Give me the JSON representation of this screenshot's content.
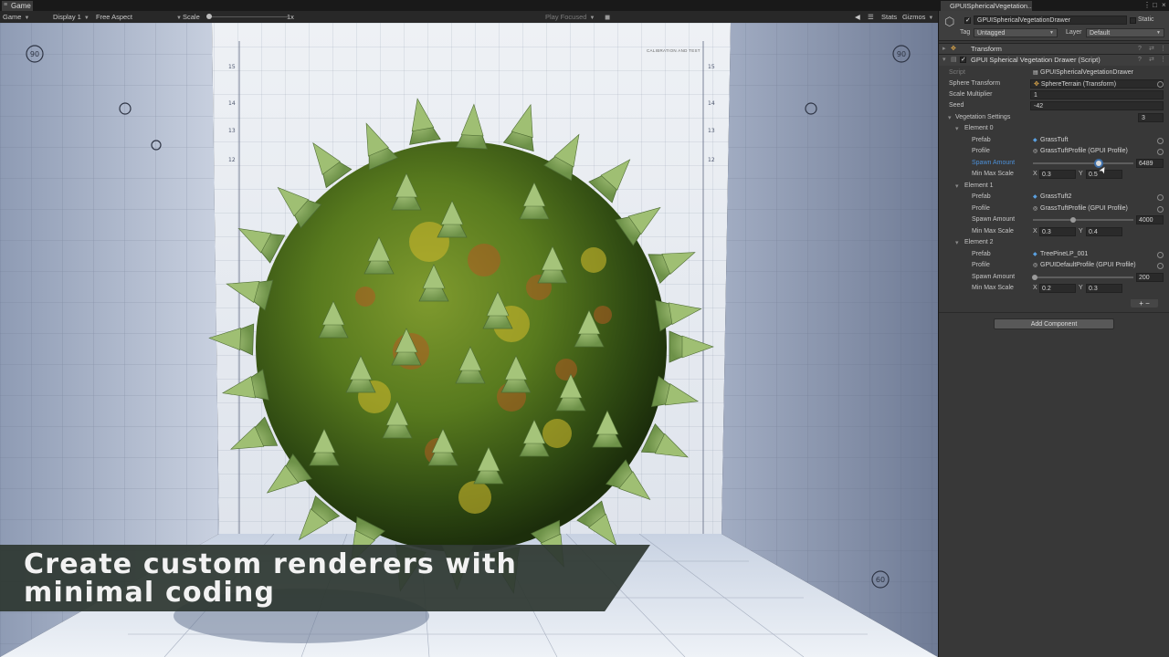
{
  "game_view": {
    "tab_label": "Game",
    "toolbar": {
      "mode": "Game",
      "display": "Display 1",
      "aspect": "Free Aspect",
      "scale_label": "Scale",
      "scale_value": "1x",
      "play_focused": "Play Focused",
      "stats": "Stats",
      "gizmos": "Gizmos"
    },
    "calibration_label": "CALIBRATION AND TEST",
    "caption": "Create custom renderers with minimal coding",
    "wall_ruler_numbers": [
      "15",
      "14",
      "13",
      "12",
      "11",
      "10",
      "9",
      "8"
    ],
    "wall_dial_numbers": [
      "90",
      "90",
      "90",
      "60",
      "60",
      "60"
    ]
  },
  "inspector": {
    "tab_label": "GPUISphericalVegetation...",
    "object_name": "GPUISphericalVegetationDrawer",
    "static_label": "Static",
    "tag_label": "Tag",
    "tag_value": "Untagged",
    "layer_label": "Layer",
    "layer_value": "Default",
    "transform_header": "Transform",
    "script_header": "GPUI Spherical Vegetation Drawer (Script)",
    "script": {
      "label": "Script",
      "value": "GPUISphericalVegetationDrawer"
    },
    "sphere_transform": {
      "label": "Sphere Transform",
      "value": "SphereTerrain (Transform)"
    },
    "scale_multiplier": {
      "label": "Scale Multiplier",
      "value": "1"
    },
    "seed": {
      "label": "Seed",
      "value": "-42"
    },
    "vegetation_settings": {
      "label": "Vegetation Settings",
      "count": "3"
    },
    "elements": [
      {
        "title": "Element 0",
        "prefab_label": "Prefab",
        "prefab": "GrassTuft",
        "profile_label": "Profile",
        "profile": "GrassTuftProfile (GPUI Profile)",
        "spawn_label": "Spawn Amount",
        "spawn": "6489",
        "spawn_fraction": 0.65,
        "scale_label": "Min Max Scale",
        "x_label": "X",
        "x": "0.3",
        "y_label": "Y",
        "y": "0.5"
      },
      {
        "title": "Element 1",
        "prefab_label": "Prefab",
        "prefab": "GrassTuft2",
        "profile_label": "Profile",
        "profile": "GrassTuftProfile (GPUI Profile)",
        "spawn_label": "Spawn Amount",
        "spawn": "4000",
        "spawn_fraction": 0.4,
        "scale_label": "Min Max Scale",
        "x_label": "X",
        "x": "0.3",
        "y_label": "Y",
        "y": "0.4"
      },
      {
        "title": "Element 2",
        "prefab_label": "Prefab",
        "prefab": "TreePineLP_001",
        "profile_label": "Profile",
        "profile": "GPUIDefaultProfile (GPUI Profile)",
        "spawn_label": "Spawn Amount",
        "spawn": "200",
        "spawn_fraction": 0.02,
        "scale_label": "Min Max Scale",
        "x_label": "X",
        "x": "0.2",
        "y_label": "Y",
        "y": "0.3"
      }
    ],
    "plus_minus": "+ −",
    "add_component": "Add Component"
  }
}
